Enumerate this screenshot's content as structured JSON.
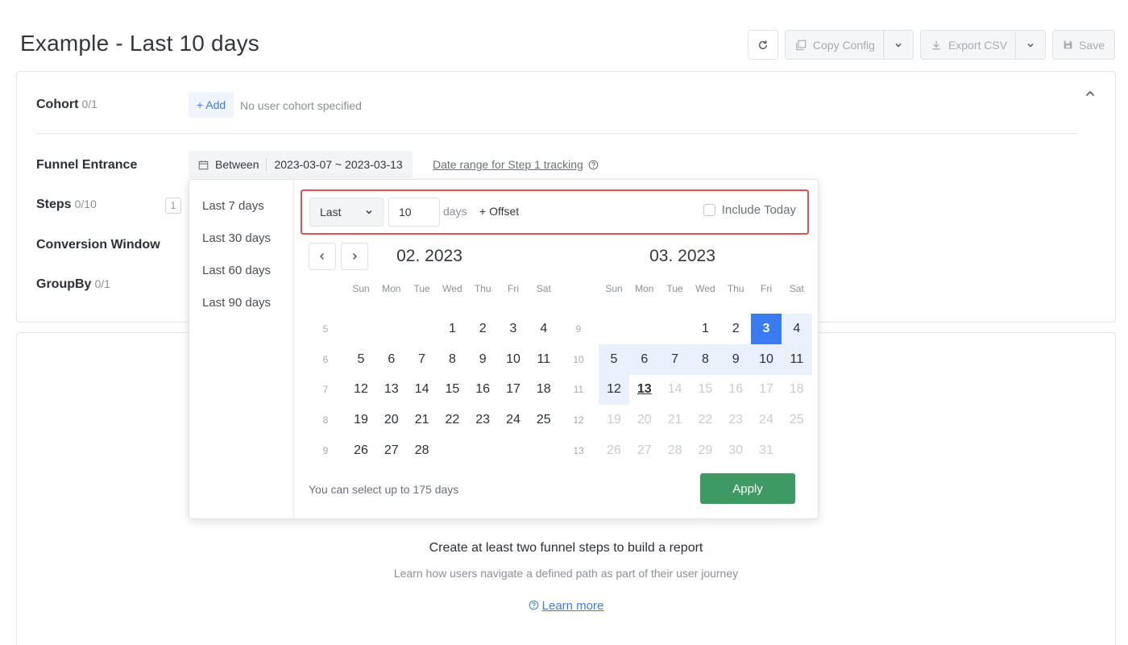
{
  "page": {
    "title": "Example - Last 10 days"
  },
  "toolbar": {
    "copy_config": "Copy Config",
    "export_csv": "Export CSV",
    "save": "Save"
  },
  "config": {
    "cohort": {
      "label": "Cohort",
      "count": "0/1",
      "add": "+ Add",
      "empty": "No user cohort specified"
    },
    "funnel_entrance": {
      "label": "Funnel Entrance",
      "mode": "Between",
      "range": "2023-03-07 ~ 2023-03-13",
      "link": "Date range for Step 1 tracking"
    },
    "steps": {
      "label": "Steps",
      "count": "0/10",
      "index": "1"
    },
    "conversion_window": {
      "label": "Conversion Window"
    },
    "groupby": {
      "label": "GroupBy",
      "count": "0/1"
    }
  },
  "empty_state": {
    "title": "Create at least two funnel steps to build a report",
    "subtitle": "Learn how users navigate a defined path as part of their user journey",
    "learn_more": "Learn more"
  },
  "datepicker": {
    "presets": [
      "Last 7 days",
      "Last 30 days",
      "Last 60 days",
      "Last 90 days"
    ],
    "relative": {
      "mode": "Last",
      "value": "10",
      "unit": "days",
      "offset": "+ Offset",
      "include_today": "Include Today"
    },
    "weekdays": [
      "Sun",
      "Mon",
      "Tue",
      "Wed",
      "Thu",
      "Fri",
      "Sat"
    ],
    "left_month": {
      "title": "02. 2023",
      "weeks": [
        {
          "num": "5",
          "days": [
            "",
            "",
            "",
            "1",
            "2",
            "3",
            "4"
          ]
        },
        {
          "num": "6",
          "days": [
            "5",
            "6",
            "7",
            "8",
            "9",
            "10",
            "11"
          ]
        },
        {
          "num": "7",
          "days": [
            "12",
            "13",
            "14",
            "15",
            "16",
            "17",
            "18"
          ]
        },
        {
          "num": "8",
          "days": [
            "19",
            "20",
            "21",
            "22",
            "23",
            "24",
            "25"
          ]
        },
        {
          "num": "9",
          "days": [
            "26",
            "27",
            "28",
            "",
            "",
            "",
            ""
          ]
        }
      ]
    },
    "right_month": {
      "title": "03. 2023",
      "weeks": [
        {
          "num": "9",
          "days": [
            "",
            "",
            "",
            "1",
            "2",
            "3",
            "4"
          ]
        },
        {
          "num": "10",
          "days": [
            "5",
            "6",
            "7",
            "8",
            "9",
            "10",
            "11"
          ]
        },
        {
          "num": "11",
          "days": [
            "12",
            "13",
            "14",
            "15",
            "16",
            "17",
            "18"
          ]
        },
        {
          "num": "12",
          "days": [
            "19",
            "20",
            "21",
            "22",
            "23",
            "24",
            "25"
          ]
        },
        {
          "num": "13",
          "days": [
            "26",
            "27",
            "28",
            "29",
            "30",
            "31",
            ""
          ]
        }
      ],
      "range_start": "3",
      "range_end": "12",
      "today": "13"
    },
    "note": "You can select up to 175 days",
    "apply": "Apply"
  },
  "colors": {
    "accent": "#3b7bf0",
    "range_fill": "#e8f1fc",
    "apply": "#3d9a62",
    "highlight_border": "#e05252"
  }
}
